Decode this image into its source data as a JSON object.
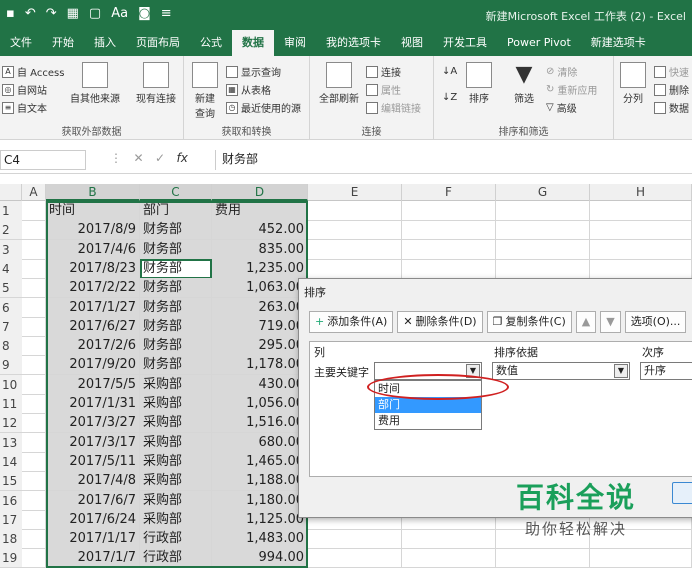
{
  "titlebar": {
    "qat": [
      "save-icon",
      "undo-icon",
      "redo-icon",
      "table-icon",
      "preview-icon",
      "format-icon",
      "camera-icon",
      "customize-icon"
    ],
    "doc_title": "新建Microsoft Excel 工作表 (2)  -  Excel"
  },
  "tabs": [
    "文件",
    "开始",
    "插入",
    "页面布局",
    "公式",
    "数据",
    "审阅",
    "我的选项卡",
    "视图",
    "开发工具",
    "Power Pivot",
    "新建选项卡"
  ],
  "active_tab": "数据",
  "ribbon": {
    "ext_data": {
      "access": "自 Access",
      "web": "自网站",
      "text": "自文本",
      "other": "自其他来源",
      "existing": "现有连接",
      "label": "获取外部数据"
    },
    "transform": {
      "new_query": "新建",
      "new_query2": "查询",
      "show_query": "显示查询",
      "from_table": "从表格",
      "recent": "最近使用的源",
      "label": "获取和转换"
    },
    "connections": {
      "refresh": "全部刷新",
      "connections": "连接",
      "properties": "属性",
      "edit_links": "编辑链接",
      "label": "连接"
    },
    "sort": {
      "sort": "排序",
      "filter": "筛选",
      "clear": "清除",
      "reapply": "重新应用",
      "advanced": "高级",
      "label": "排序和筛选"
    },
    "tools": {
      "split": "分列",
      "flash": "快速",
      "remove_dup": "删除",
      "validate": "数据"
    }
  },
  "formula_bar": {
    "name_box": "C4",
    "fx": "fx",
    "value": "财务部"
  },
  "columns": [
    "A",
    "B",
    "C",
    "D",
    "E",
    "F",
    "G",
    "H"
  ],
  "headers": {
    "time": "时间",
    "dept": "部门",
    "cost": "费用"
  },
  "rows": [
    [
      "2017/8/9",
      "财务部",
      "452.00"
    ],
    [
      "2017/4/6",
      "财务部",
      "835.00"
    ],
    [
      "2017/8/23",
      "财务部",
      "1,235.00"
    ],
    [
      "2017/2/22",
      "财务部",
      "1,063.00"
    ],
    [
      "2017/1/27",
      "财务部",
      "263.00"
    ],
    [
      "2017/6/27",
      "财务部",
      "719.00"
    ],
    [
      "2017/2/6",
      "财务部",
      "295.00"
    ],
    [
      "2017/9/20",
      "财务部",
      "1,178.00"
    ],
    [
      "2017/5/5",
      "采购部",
      "430.00"
    ],
    [
      "2017/1/31",
      "采购部",
      "1,056.00"
    ],
    [
      "2017/3/27",
      "采购部",
      "1,516.00"
    ],
    [
      "2017/3/17",
      "采购部",
      "680.00"
    ],
    [
      "2017/5/11",
      "采购部",
      "1,465.00"
    ],
    [
      "2017/4/8",
      "采购部",
      "1,188.00"
    ],
    [
      "2017/6/7",
      "采购部",
      "1,180.00"
    ],
    [
      "2017/6/24",
      "采购部",
      "1,125.00"
    ],
    [
      "2017/1/17",
      "行政部",
      "1,483.00"
    ],
    [
      "2017/1/7",
      "行政部",
      "994.00"
    ]
  ],
  "row_numbers": [
    "1",
    "2",
    "3",
    "4",
    "5",
    "6",
    "7",
    "8",
    "9",
    "10",
    "11",
    "12",
    "13",
    "14",
    "15",
    "16",
    "17",
    "18",
    "19"
  ],
  "dialog": {
    "title": "排序",
    "add": "添加条件(A)",
    "delete": "删除条件(D)",
    "copy": "复制条件(C)",
    "options": "选项(O)...",
    "col_header": "列",
    "sort_on_header": "排序依据",
    "order_header": "次序",
    "primary_key": "主要关键字",
    "sort_on": "数值",
    "order": "升序",
    "dropdown_items": [
      "时间",
      "部门",
      "费用"
    ],
    "highlighted": "部门"
  },
  "watermark": {
    "title": "百科全说",
    "subtitle": "助你轻松解决"
  }
}
